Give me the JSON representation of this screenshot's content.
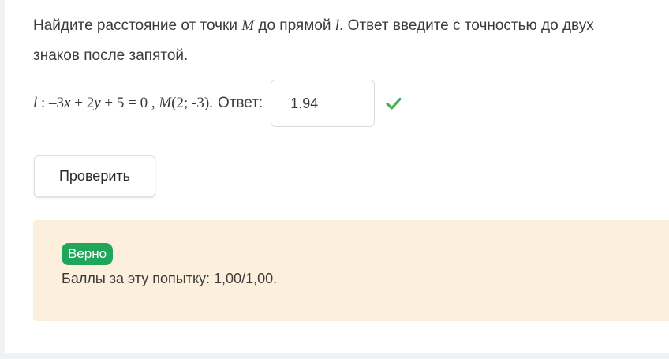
{
  "question": {
    "part1": "Найдите расстояние от точки ",
    "point_var": "M",
    "part2": " до прямой ",
    "line_var": "l",
    "part3": ". Ответ введите с точностью до двух знаков после запятой."
  },
  "answer_line": {
    "formula": "l : –3x + 2y + 5 = 0 , M(2; -3).",
    "answer_label": "Ответ:",
    "answer_value": "1.94",
    "status_icon": "check-icon",
    "status_color": "#4caf50"
  },
  "check_button": {
    "label": "Проверить"
  },
  "feedback": {
    "badge": "Верно",
    "badge_color": "#1fa65a",
    "background": "#fcefdc",
    "score": "Баллы за эту попытку: 1,00/1,00."
  }
}
